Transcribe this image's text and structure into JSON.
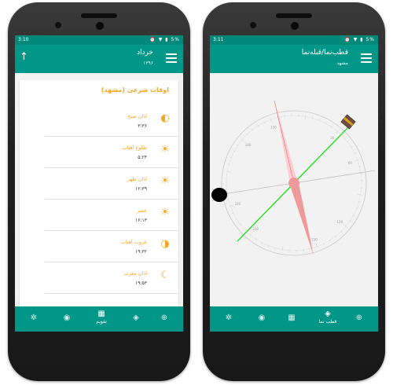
{
  "left": {
    "status": {
      "time": "3:10",
      "icons": "⏰ ▼ ▮ 5%"
    },
    "appbar": {
      "title": "خرداد",
      "subtitle": "۱۳۹۶"
    },
    "card": {
      "title": "اوقات شرعی (مشهد)",
      "rows": [
        {
          "name": "اذان صبح",
          "time": "۳:۳۶",
          "icon": "sunrise-icon"
        },
        {
          "name": "طلوع آفتاب",
          "time": "۵:۲۴",
          "icon": "sun-icon"
        },
        {
          "name": "اذان ظهر",
          "time": "۱۲:۳۹",
          "icon": "sun-icon"
        },
        {
          "name": "عصر",
          "time": "۱۶:۱۳",
          "icon": "sun-icon"
        },
        {
          "name": "غروب آفتاب",
          "time": "۱۹:۳۲",
          "icon": "sunset-icon"
        },
        {
          "name": "اذان مغرب",
          "time": "۱۹:۵۳",
          "icon": "moon-icon"
        }
      ]
    },
    "nav": {
      "calendar_label": "تقویم"
    }
  },
  "right": {
    "status": {
      "time": "3:11",
      "icons": "⏰ ▼ ▮ 5%"
    },
    "appbar": {
      "title": "قطب‌نما/قبله‌نما",
      "subtitle": "مشهد"
    },
    "compass": {
      "ticks": [
        "30",
        "60",
        "120",
        "150",
        "210",
        "240",
        "300",
        "330"
      ]
    },
    "nav": {
      "compass_label": "قطب نما"
    }
  },
  "colors": {
    "primary": "#009688",
    "status": "#00897b",
    "accent": "#f5a623",
    "qibla_line": "#00e000",
    "needle": "#ef9a9a"
  }
}
